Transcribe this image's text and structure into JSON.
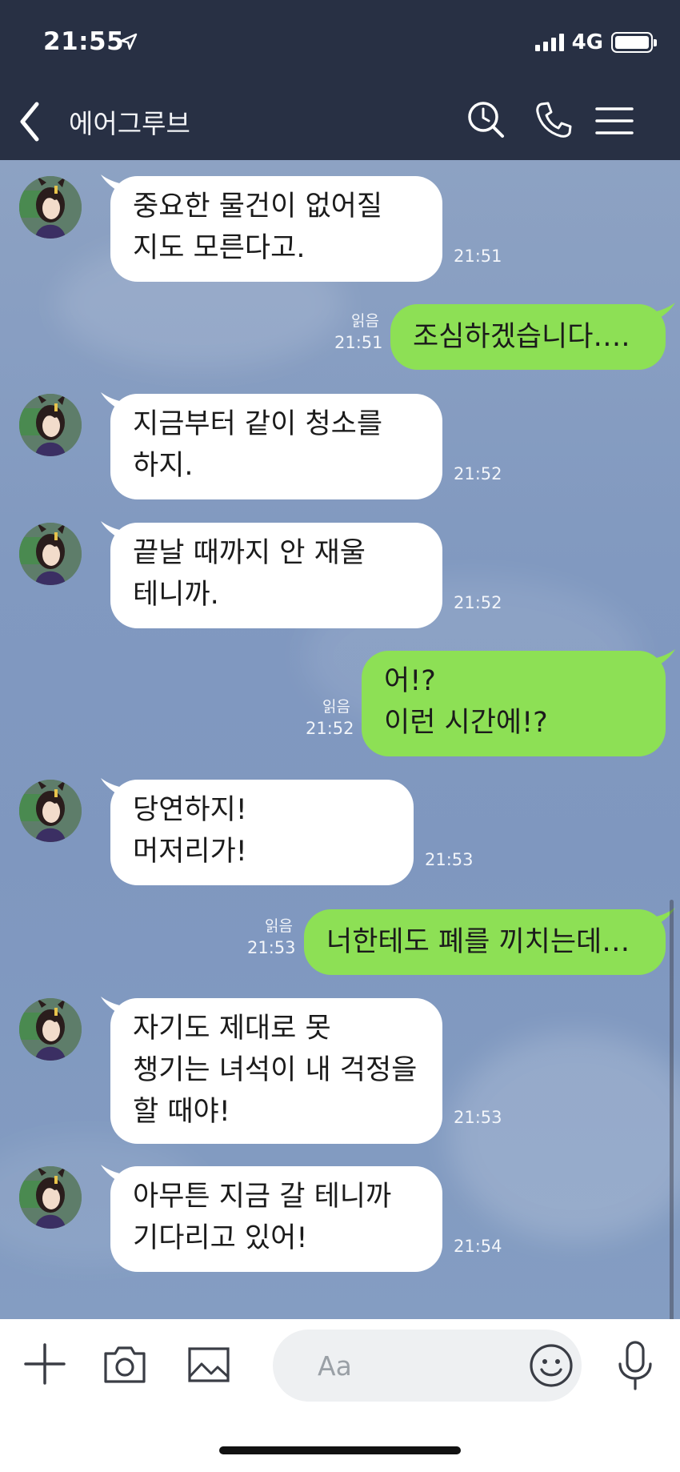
{
  "status": {
    "time": "21:55",
    "network": "4G"
  },
  "header": {
    "title": "에어그루브"
  },
  "messages": [
    {
      "dir": "in",
      "lines": [
        "중요한 물건이 없어질",
        "지도 모른다고."
      ],
      "time": "21:51"
    },
    {
      "dir": "out",
      "lines": [
        "조심하겠습니다…."
      ],
      "time": "21:51",
      "read": "읽음"
    },
    {
      "dir": "in",
      "lines": [
        "지금부터 같이 청소를",
        "하지."
      ],
      "time": "21:52"
    },
    {
      "dir": "in",
      "lines": [
        "끝날 때까지 안 재울",
        "테니까."
      ],
      "time": "21:52"
    },
    {
      "dir": "out",
      "lines": [
        "어!?",
        "이런 시간에!?"
      ],
      "time": "21:52",
      "read": "읽음"
    },
    {
      "dir": "in",
      "lines": [
        "당연하지!",
        "머저리가!"
      ],
      "time": "21:53"
    },
    {
      "dir": "out",
      "lines": [
        "너한테도 폐를 끼치는데…"
      ],
      "time": "21:53",
      "read": "읽음"
    },
    {
      "dir": "in",
      "lines": [
        "자기도 제대로 못",
        "챙기는 녀석이 내 걱정을",
        "할 때야!"
      ],
      "time": "21:53"
    },
    {
      "dir": "in",
      "lines": [
        "아무튼 지금 갈 테니까",
        "기다리고 있어!"
      ],
      "time": "21:54"
    }
  ],
  "input": {
    "placeholder": "Aa"
  },
  "icons": {
    "back": "back-arrow-icon",
    "search": "search-icon",
    "call": "phone-icon",
    "menu": "menu-icon",
    "add": "plus-icon",
    "camera": "camera-icon",
    "image": "image-icon",
    "emoji": "emoji-icon",
    "mic": "mic-icon"
  },
  "colors": {
    "header": "#283044",
    "incoming": "#ffffff",
    "outgoing": "#8de055",
    "chat_bg": "#8199c0"
  }
}
